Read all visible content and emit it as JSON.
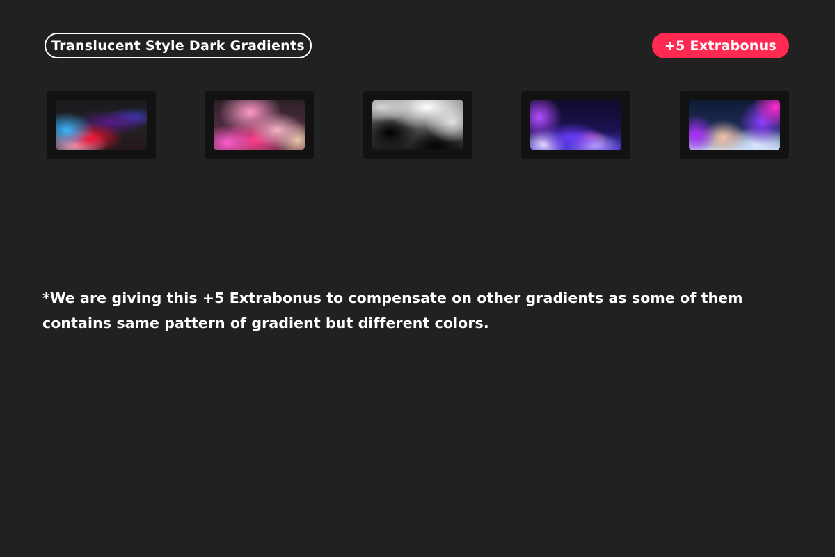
{
  "header": {
    "title": "Translucent Style Dark Gradients",
    "badge": "+5 Extrabonus"
  },
  "colors": {
    "background": "#212121",
    "badge": "#ff2952",
    "thumb_frame": "#121212",
    "text": "#ffffff"
  },
  "thumbnails": [
    {
      "name": "gradient-preview-1",
      "palette": [
        "#38b6ff",
        "#ff1030",
        "#ffd6ee",
        "#5a1a8a",
        "#1b1b1f"
      ]
    },
    {
      "name": "gradient-preview-2",
      "palette": [
        "#ff9ac6",
        "#f5b7c8",
        "#e6c8a6",
        "#ff5cd0",
        "#ff3d8a"
      ]
    },
    {
      "name": "gradient-preview-3",
      "palette": [
        "#ffffff",
        "#e0e0e0",
        "#000000",
        "#8a8a8a"
      ]
    },
    {
      "name": "gradient-preview-4",
      "palette": [
        "#b44cff",
        "#6a3cff",
        "#b9a2ff",
        "#e7d8ff",
        "#0e0b2a"
      ]
    },
    {
      "name": "gradient-preview-5",
      "palette": [
        "#ff2ad6",
        "#8d3cff",
        "#b02cff",
        "#f3c2a6",
        "#d8e6ff"
      ]
    }
  ],
  "note": "*We are giving this +5 Extrabonus to compensate on other gradients as some of them contains same pattern of gradient but different colors."
}
